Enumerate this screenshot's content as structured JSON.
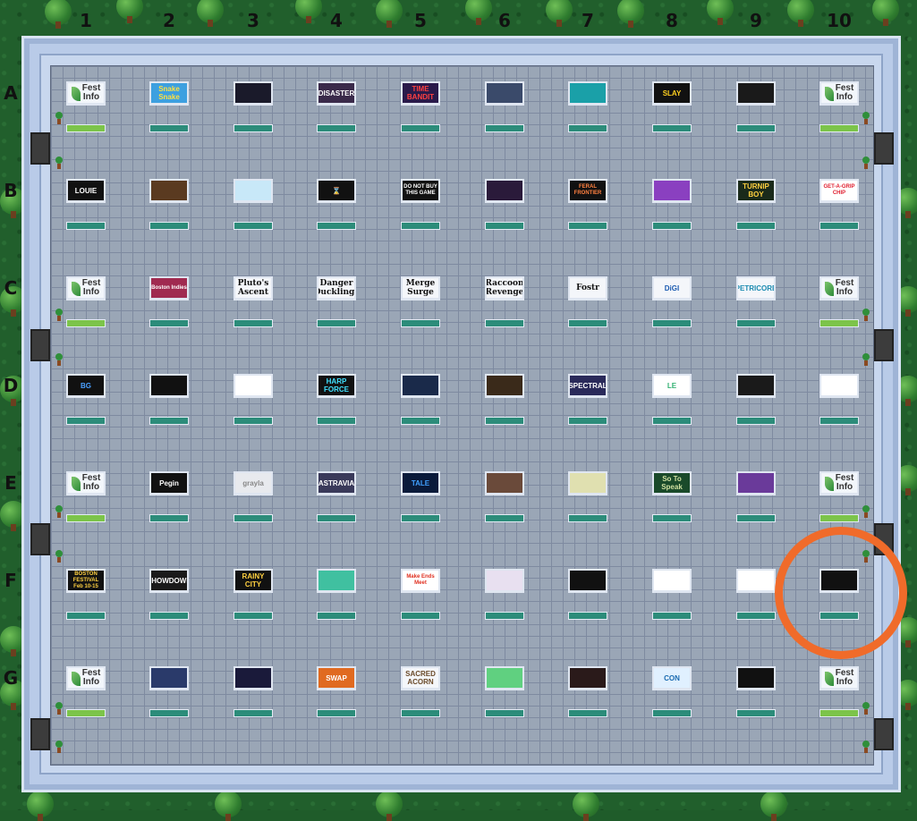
{
  "columns": [
    "1",
    "2",
    "3",
    "4",
    "5",
    "6",
    "7",
    "8",
    "9",
    "10"
  ],
  "rows": [
    "A",
    "B",
    "C",
    "D",
    "E",
    "F",
    "G"
  ],
  "colors": {
    "highlight": "#f06b2a",
    "mat_teal": "#2c8c7a",
    "mat_green": "#7cc44a",
    "floor": "#9aa6b6"
  },
  "highlighted_booth": {
    "row": "F",
    "column": "10"
  },
  "booths": {
    "A": [
      {
        "type": "fest",
        "text": "Fest Info"
      },
      {
        "type": "logo",
        "text": "Snake Snake",
        "bg": "#3da0e0",
        "fg": "#ffe040"
      },
      {
        "type": "logo",
        "text": "",
        "bg": "#1a1a2a",
        "fg": "#fff"
      },
      {
        "type": "logo",
        "text": "DISASTER",
        "bg": "#3a2a4a",
        "fg": "#fff"
      },
      {
        "type": "logo",
        "text": "TIME BANDIT",
        "bg": "#2a1a4a",
        "fg": "#ff4040"
      },
      {
        "type": "logo",
        "text": "",
        "bg": "#3a4a6a",
        "fg": "#fff"
      },
      {
        "type": "logo",
        "text": "",
        "bg": "#1aa0a8",
        "fg": "#ffb040"
      },
      {
        "type": "logo",
        "text": "SLAY",
        "bg": "#111",
        "fg": "#ffd020"
      },
      {
        "type": "logo",
        "text": "",
        "bg": "#1a1a1a",
        "fg": "#fff"
      },
      {
        "type": "fest",
        "text": "Fest Info"
      }
    ],
    "B": [
      {
        "type": "logo",
        "text": "LOUIE",
        "bg": "#111",
        "fg": "#fff"
      },
      {
        "type": "logo",
        "text": "",
        "bg": "#5a3a20",
        "fg": "#fff"
      },
      {
        "type": "logo",
        "text": "",
        "bg": "#c8e8f8",
        "fg": "#e04050"
      },
      {
        "type": "logo",
        "text": "⌛",
        "bg": "#111",
        "fg": "#fff"
      },
      {
        "type": "logo",
        "text": "DO NOT BUY THIS GAME",
        "bg": "#111",
        "fg": "#fff"
      },
      {
        "type": "logo",
        "text": "",
        "bg": "#2a1a3a",
        "fg": "#fff"
      },
      {
        "type": "logo",
        "text": "FERAL FRONTIER",
        "bg": "#111",
        "fg": "#ff8040"
      },
      {
        "type": "logo",
        "text": "",
        "bg": "#8a40c0",
        "fg": "#fff"
      },
      {
        "type": "logo",
        "text": "TURNIP BOY",
        "bg": "#1a2a1a",
        "fg": "#ffd040"
      },
      {
        "type": "logo",
        "text": "GET-A-GRIP CHIP",
        "bg": "#fff",
        "fg": "#e02030"
      }
    ],
    "C": [
      {
        "type": "fest",
        "text": "Fest Info"
      },
      {
        "type": "logo",
        "text": "Boston Indies",
        "bg": "#a02a50",
        "fg": "#fff"
      },
      {
        "type": "text",
        "text": "Pluto's Ascent"
      },
      {
        "type": "text",
        "text": "Danger Ducklings"
      },
      {
        "type": "text",
        "text": "Merge Surge"
      },
      {
        "type": "text",
        "text": "Raccoon Revenge"
      },
      {
        "type": "text",
        "text": "Fostr"
      },
      {
        "type": "logo",
        "text": "DiGI",
        "bg": "#f4f6fa",
        "fg": "#1a5ab0"
      },
      {
        "type": "logo",
        "text": "PETRICORE",
        "bg": "#f4f6fa",
        "fg": "#1a8ab0"
      },
      {
        "type": "fest",
        "text": "Fest Info"
      }
    ],
    "D": [
      {
        "type": "logo",
        "text": "BG",
        "bg": "#111",
        "fg": "#4aa0ff"
      },
      {
        "type": "logo",
        "text": "",
        "bg": "#111",
        "fg": "#fff"
      },
      {
        "type": "logo",
        "text": "",
        "bg": "#fff",
        "fg": "#111"
      },
      {
        "type": "logo",
        "text": "HARP FORCE",
        "bg": "#111",
        "fg": "#40e0ff"
      },
      {
        "type": "logo",
        "text": "",
        "bg": "#1a2a4a",
        "fg": "#ff40a0"
      },
      {
        "type": "logo",
        "text": "",
        "bg": "#3a2a1a",
        "fg": "#fff"
      },
      {
        "type": "logo",
        "text": "SPECTRAL",
        "bg": "#2a2a5a",
        "fg": "#fff"
      },
      {
        "type": "logo",
        "text": "LE",
        "bg": "#fff",
        "fg": "#30b070"
      },
      {
        "type": "logo",
        "text": "",
        "bg": "#1a1a1a",
        "fg": "#ffd040"
      },
      {
        "type": "logo",
        "text": "",
        "bg": "#fff",
        "fg": "#1a2a8a"
      }
    ],
    "E": [
      {
        "type": "fest",
        "text": "Fest Info"
      },
      {
        "type": "logo",
        "text": "Pegin",
        "bg": "#111",
        "fg": "#fff"
      },
      {
        "type": "logo",
        "text": "grayla",
        "bg": "#e8eaee",
        "fg": "#888"
      },
      {
        "type": "logo",
        "text": "ASTRAVIA",
        "bg": "#3a3a5a",
        "fg": "#fff"
      },
      {
        "type": "logo",
        "text": "TALE",
        "bg": "#0a1a3a",
        "fg": "#40a0ff"
      },
      {
        "type": "logo",
        "text": "",
        "bg": "#6a4a3a",
        "fg": "#fff"
      },
      {
        "type": "logo",
        "text": "",
        "bg": "#e0e0b0",
        "fg": "#6a5a2a"
      },
      {
        "type": "logo",
        "text": "So To Speak",
        "bg": "#1a4a2a",
        "fg": "#d0e0a0"
      },
      {
        "type": "logo",
        "text": "",
        "bg": "#6a3a9a",
        "fg": "#ffd040"
      },
      {
        "type": "fest",
        "text": "Fest Info"
      }
    ],
    "F": [
      {
        "type": "logo",
        "text": "BOSTON FESTIVAL Feb 10-15",
        "bg": "#111",
        "fg": "#ffd040"
      },
      {
        "type": "logo",
        "text": "SHOWDOWN",
        "bg": "#1a1a1a",
        "fg": "#fff"
      },
      {
        "type": "logo",
        "text": "RAINY CITY",
        "bg": "#111",
        "fg": "#ffd040"
      },
      {
        "type": "logo",
        "text": "",
        "bg": "#40c0a0",
        "fg": "#ff8040"
      },
      {
        "type": "logo",
        "text": "Make Ends Meet",
        "bg": "#fff",
        "fg": "#e03020"
      },
      {
        "type": "logo",
        "text": "",
        "bg": "#e8e0f0",
        "fg": "#6a3a8a"
      },
      {
        "type": "logo",
        "text": "",
        "bg": "#111",
        "fg": "#ccc"
      },
      {
        "type": "logo",
        "text": "",
        "bg": "#fff",
        "fg": "#111"
      },
      {
        "type": "logo",
        "text": "",
        "bg": "#fff",
        "fg": "#1a3a8a"
      },
      {
        "type": "logo",
        "text": "",
        "bg": "#111",
        "fg": "#ff4080"
      }
    ],
    "G": [
      {
        "type": "fest",
        "text": "Fest Info"
      },
      {
        "type": "logo",
        "text": "",
        "bg": "#2a3a6a",
        "fg": "#fff"
      },
      {
        "type": "logo",
        "text": "",
        "bg": "#1a1a3a",
        "fg": "#fff"
      },
      {
        "type": "logo",
        "text": "SWAP",
        "bg": "#e06a20",
        "fg": "#fff"
      },
      {
        "type": "logo",
        "text": "SACRED ACORN",
        "bg": "#f4f6fa",
        "fg": "#6a4a2a"
      },
      {
        "type": "logo",
        "text": "",
        "bg": "#60d080",
        "fg": "#fff"
      },
      {
        "type": "logo",
        "text": "",
        "bg": "#2a1a1a",
        "fg": "#fff"
      },
      {
        "type": "logo",
        "text": "CON",
        "bg": "#e0f0ff",
        "fg": "#1a6ab0"
      },
      {
        "type": "logo",
        "text": "",
        "bg": "#111",
        "fg": "#e04050"
      },
      {
        "type": "fest",
        "text": "Fest Info"
      }
    ]
  }
}
